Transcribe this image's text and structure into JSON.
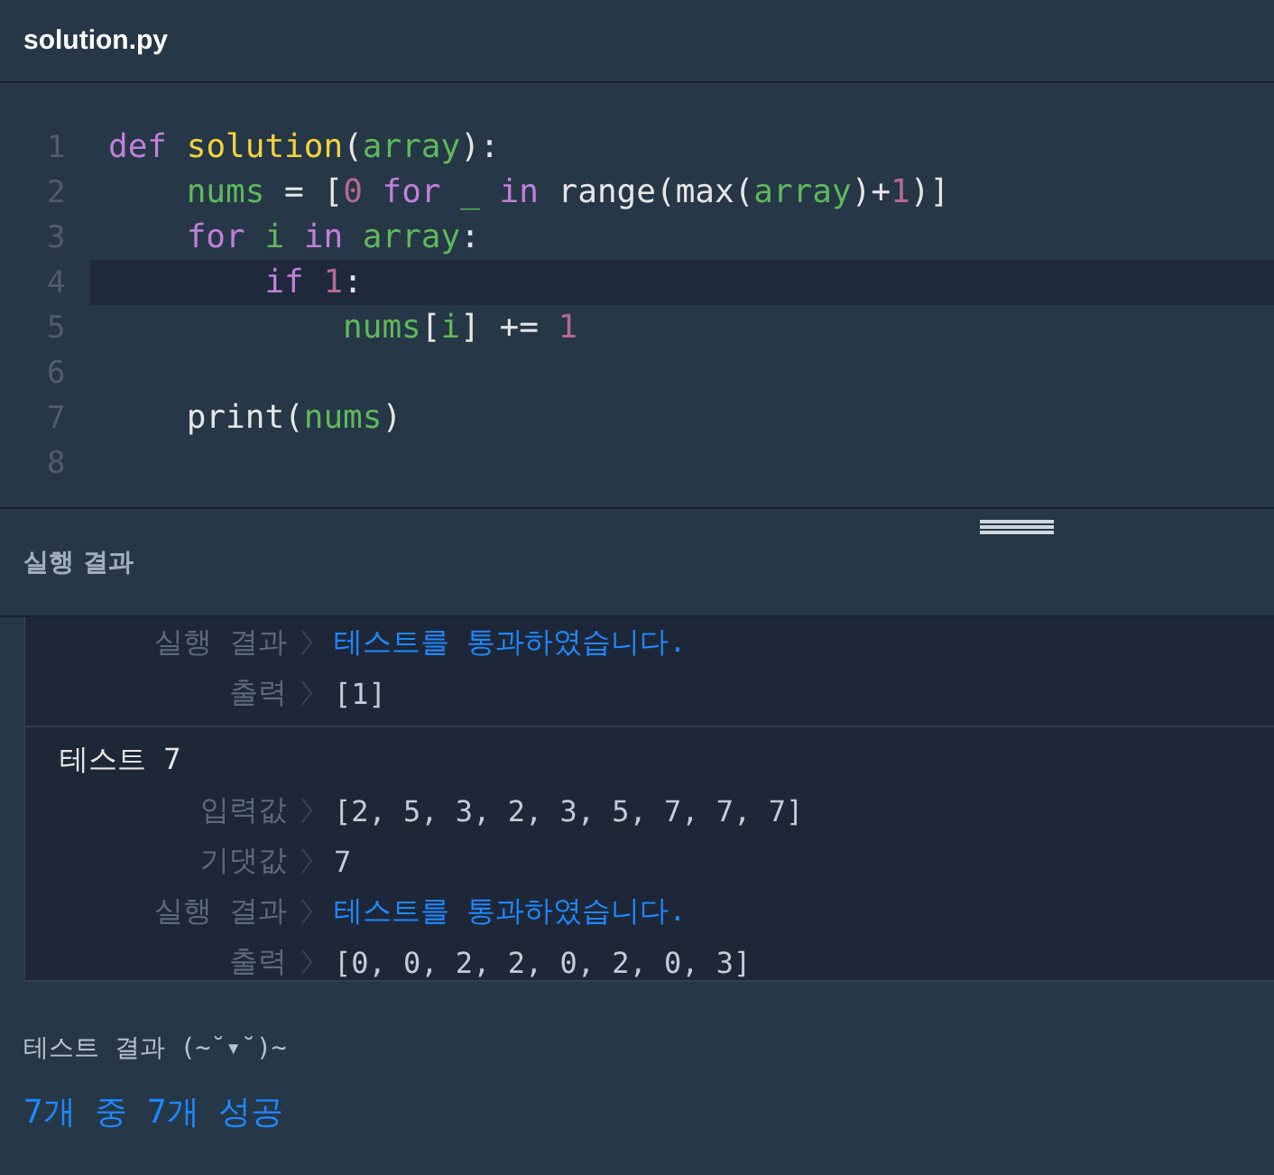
{
  "file_tab": {
    "title": "solution.py"
  },
  "editor": {
    "lines": [
      {
        "number": "1",
        "highlighted": false,
        "tokens": [
          {
            "kind": "keyword",
            "text": "def "
          },
          {
            "kind": "func",
            "text": "solution"
          },
          {
            "kind": "plain",
            "text": "("
          },
          {
            "kind": "var",
            "text": "array"
          },
          {
            "kind": "plain",
            "text": "):"
          }
        ]
      },
      {
        "number": "2",
        "highlighted": false,
        "tokens": [
          {
            "kind": "var",
            "text": "    nums"
          },
          {
            "kind": "plain",
            "text": " = ["
          },
          {
            "kind": "num",
            "text": "0"
          },
          {
            "kind": "keyword",
            "text": " for "
          },
          {
            "kind": "var",
            "text": "_"
          },
          {
            "kind": "keyword",
            "text": " in "
          },
          {
            "kind": "plain",
            "text": "range(max("
          },
          {
            "kind": "var",
            "text": "array"
          },
          {
            "kind": "plain",
            "text": ")+"
          },
          {
            "kind": "num",
            "text": "1"
          },
          {
            "kind": "plain",
            "text": ")]"
          }
        ]
      },
      {
        "number": "3",
        "highlighted": false,
        "tokens": [
          {
            "kind": "keyword",
            "text": "    for "
          },
          {
            "kind": "var",
            "text": "i"
          },
          {
            "kind": "keyword",
            "text": " in "
          },
          {
            "kind": "var",
            "text": "array"
          },
          {
            "kind": "plain",
            "text": ":"
          }
        ]
      },
      {
        "number": "4",
        "highlighted": true,
        "tokens": [
          {
            "kind": "keyword",
            "text": "        if "
          },
          {
            "kind": "num",
            "text": "1"
          },
          {
            "kind": "plain",
            "text": ":"
          }
        ]
      },
      {
        "number": "5",
        "highlighted": false,
        "tokens": [
          {
            "kind": "var",
            "text": "            nums"
          },
          {
            "kind": "plain",
            "text": "["
          },
          {
            "kind": "var",
            "text": "i"
          },
          {
            "kind": "plain",
            "text": "] += "
          },
          {
            "kind": "num",
            "text": "1"
          }
        ]
      },
      {
        "number": "6",
        "highlighted": false
      },
      {
        "number": "7",
        "highlighted": false,
        "tokens": [
          {
            "kind": "plain",
            "text": "    print("
          },
          {
            "kind": "var",
            "text": "nums"
          },
          {
            "kind": "plain",
            "text": ")"
          }
        ]
      },
      {
        "number": "8",
        "highlighted": false
      }
    ]
  },
  "result_panel": {
    "title": "실행 결과",
    "tests": [
      {
        "rows": [
          {
            "label": "실행 결과",
            "kind": "message",
            "value": "테스트를 통과하였습니다."
          },
          {
            "label": "출력",
            "kind": "value",
            "value": "[1]"
          }
        ]
      },
      {
        "title": "테스트 7",
        "rows": [
          {
            "label": "입력값",
            "kind": "value",
            "value": "[2, 5, 3, 2, 3, 5, 7, 7, 7]"
          },
          {
            "label": "기댓값",
            "kind": "value",
            "value": "7"
          },
          {
            "label": "실행 결과",
            "kind": "message",
            "value": "테스트를 통과하였습니다."
          },
          {
            "label": "출력",
            "kind": "value",
            "value": "[0, 0, 2, 2, 0, 2, 0, 3]"
          }
        ]
      }
    ],
    "summary_label": "테스트 결과 (~˘▾˘)~",
    "summary": "7개 중 7개 성공"
  }
}
